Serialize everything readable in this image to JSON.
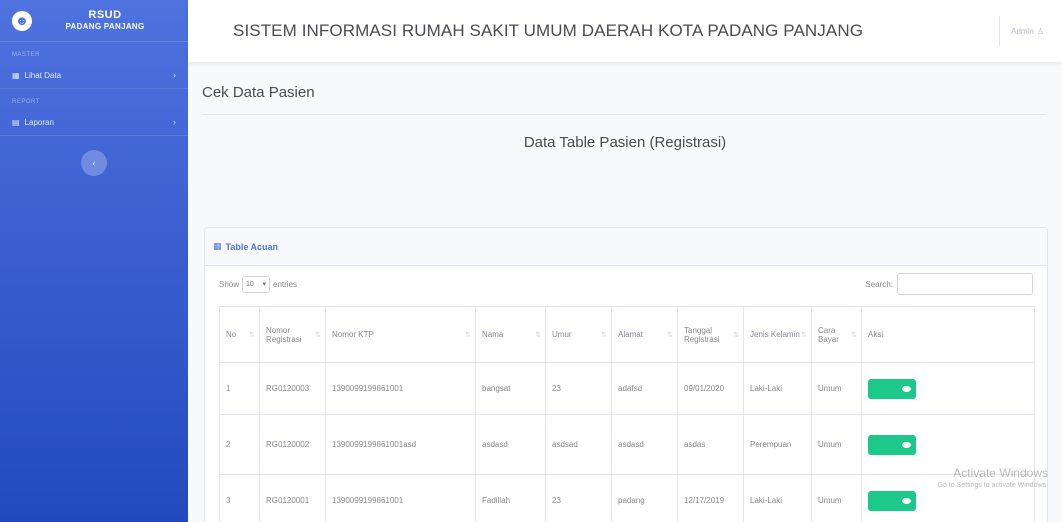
{
  "sidebar": {
    "brand_line1": "RSUD",
    "brand_line2": "PADANG PANJANG",
    "heading1": "MASTER",
    "item1": "Lihat Data",
    "heading2": "REPORT",
    "item2": "Laporan",
    "toggle_icon": "‹"
  },
  "topbar": {
    "title": "SISTEM INFORMASI RUMAH SAKIT UMUM DAERAH KOTA PADANG PANJANG",
    "user": "Admin"
  },
  "page": {
    "title": "Cek Data Pasien",
    "section_title": "Data Table Pasien (Registrasi)"
  },
  "card": {
    "header": "Table Acuan",
    "show_label": "Show",
    "entries_value": "10",
    "entries_label": "entries",
    "search_label": "Search:"
  },
  "table": {
    "headers": [
      "No",
      "Nomor Registrasi",
      "Nomor KTP",
      "Nama",
      "Umur",
      "Alamat",
      "Tanggal Registrasi",
      "Jenis Kelamin",
      "Cara Bayar",
      "Aksi"
    ],
    "rows": [
      [
        "1",
        "RG0120003",
        "1390099199861001",
        "bangsat",
        "23",
        "adafsd",
        "09/01/2020",
        "Laki-Laki",
        "Umum"
      ],
      [
        "2",
        "RG0120002",
        "1390099199861001asd",
        "asdasd",
        "asdsad",
        "asdasd",
        "asdas",
        "Perempuan",
        "Umum"
      ],
      [
        "3",
        "RG0120001",
        "1390099199861001",
        "Fadillah",
        "23",
        "padang",
        "12/17/2019",
        "Laki-Laki",
        "Umum"
      ]
    ]
  },
  "watermark": {
    "line1": "Activate Windows",
    "line2": "Go to Settings to activate Windows."
  }
}
